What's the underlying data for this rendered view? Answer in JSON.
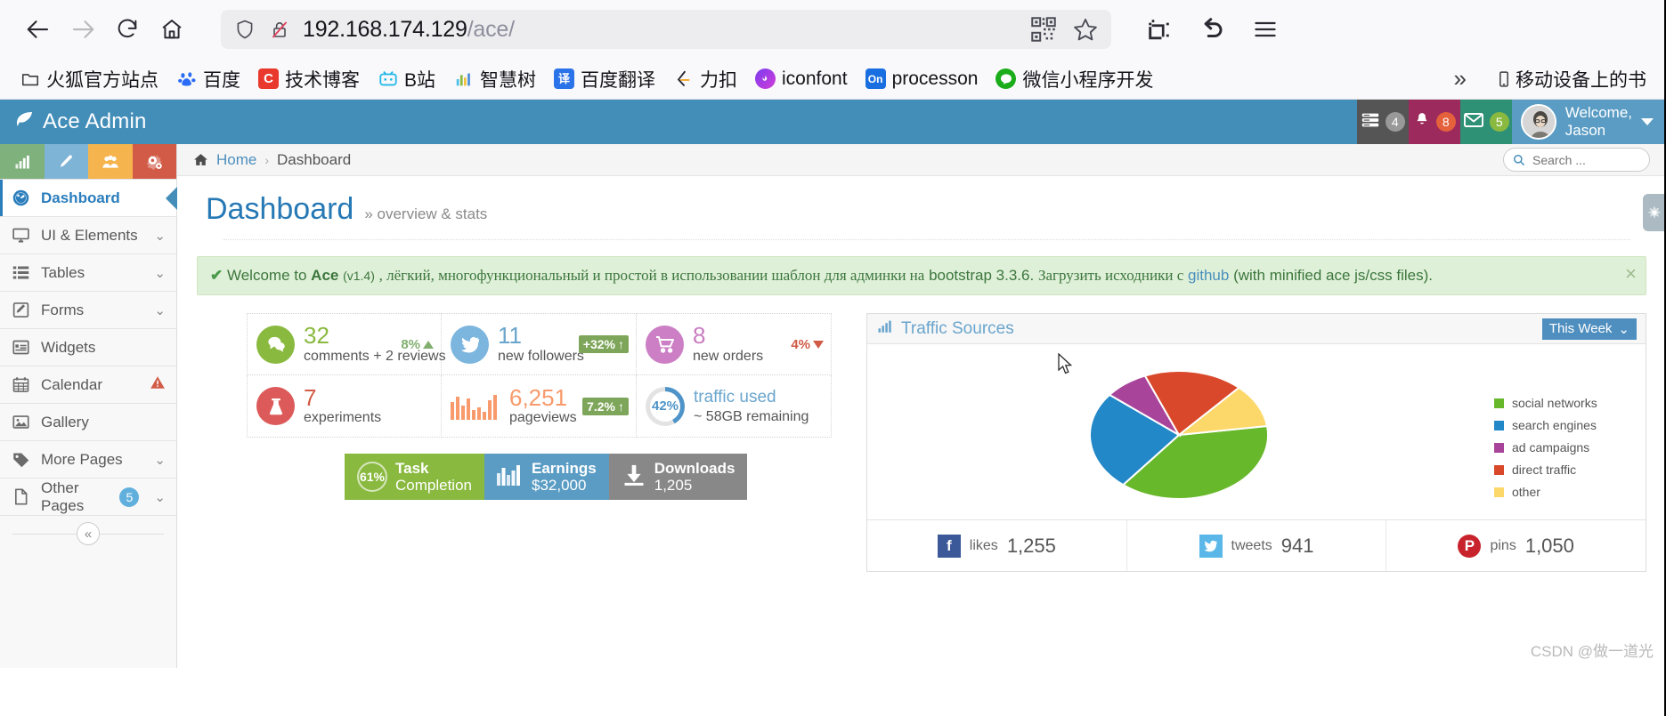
{
  "browser": {
    "url_host": "192.168.174.129",
    "url_path": "/ace/",
    "back_icon": "back-arrow-icon",
    "forward_icon": "forward-arrow-icon",
    "reload_icon": "reload-icon",
    "home_icon": "home-icon",
    "shield_icon": "shield-icon",
    "lock_broken_icon": "lock-crossed-icon",
    "qr_icon": "qr-code-icon",
    "star_icon": "bookmark-star-icon",
    "screenshot_icon": "screenshot-crop-icon",
    "undo_icon": "undo-arrow-icon",
    "menu_icon": "hamburger-menu-icon",
    "bookmarks": [
      {
        "label": "火狐官方站点",
        "icon": "folder-icon",
        "color": "#ffffff"
      },
      {
        "label": "百度",
        "icon": "baidu-paw-icon",
        "color": "#ffffff"
      },
      {
        "label": "技术博客",
        "icon": "csdn-c-icon",
        "color": "#e8392c"
      },
      {
        "label": "B站",
        "icon": "bilibili-icon",
        "color": "#ffffff"
      },
      {
        "label": "智慧树",
        "icon": "zhihuishu-bars-icon",
        "color": "#ffffff"
      },
      {
        "label": "百度翻译",
        "icon": "fanyi-icon",
        "color": "#2b73e8"
      },
      {
        "label": "力扣",
        "icon": "leetcode-icon",
        "color": "#ffffff"
      },
      {
        "label": "iconfont",
        "icon": "iconfont-icon",
        "color": "#8b3de8"
      },
      {
        "label": "processon",
        "icon": "processon-on-icon",
        "color": "#1a6fe0"
      },
      {
        "label": "微信小程序开发",
        "icon": "wechat-icon",
        "color": "#1aad19"
      }
    ],
    "overflow_label": "移动设备上的书",
    "overflow_chevron": "»",
    "mobile_icon": "mobile-device-icon"
  },
  "app": {
    "brand": "Ace Admin",
    "brand_icon": "leaf-icon",
    "shortcuts": [
      {
        "name": "stats-shortcut",
        "icon": "bar-chart-icon",
        "color": "#7eb17c"
      },
      {
        "name": "edit-shortcut",
        "icon": "pencil-icon",
        "color": "#7eb4d6"
      },
      {
        "name": "users-shortcut",
        "icon": "group-icon",
        "color": "#f5b44d"
      },
      {
        "name": "settings-shortcut",
        "icon": "cogs-icon",
        "color": "#d15b47"
      }
    ],
    "navbar": {
      "tasks": {
        "icon": "tasks-icon",
        "count": "4"
      },
      "notifications": {
        "icon": "bell-icon",
        "count": "8"
      },
      "mail": {
        "icon": "envelope-icon",
        "count": "5"
      },
      "user": {
        "greeting": "Welcome,",
        "name": "Jason",
        "avatar": "user-avatar"
      }
    }
  },
  "sidebar": {
    "items": [
      {
        "label": "Dashboard",
        "icon": "dashboard-gauge-icon",
        "active": true,
        "chevron": "",
        "badge": "",
        "warn": false
      },
      {
        "label": "UI & Elements",
        "icon": "desktop-icon",
        "active": false,
        "chevron": "⌄",
        "badge": "",
        "warn": false
      },
      {
        "label": "Tables",
        "icon": "list-icon",
        "active": false,
        "chevron": "⌄",
        "badge": "",
        "warn": false
      },
      {
        "label": "Forms",
        "icon": "form-edit-icon",
        "active": false,
        "chevron": "⌄",
        "badge": "",
        "warn": false
      },
      {
        "label": "Widgets",
        "icon": "widget-icon",
        "active": false,
        "chevron": "",
        "badge": "",
        "warn": false
      },
      {
        "label": "Calendar",
        "icon": "calendar-icon",
        "active": false,
        "chevron": "",
        "badge": "",
        "warn": true
      },
      {
        "label": "Gallery",
        "icon": "image-icon",
        "active": false,
        "chevron": "",
        "badge": "",
        "warn": false
      },
      {
        "label": "More Pages",
        "icon": "tag-icon",
        "active": false,
        "chevron": "⌄",
        "badge": "",
        "warn": false
      },
      {
        "label": "Other Pages",
        "icon": "file-icon",
        "active": false,
        "chevron": "⌄",
        "badge": "5",
        "warn": false
      }
    ],
    "collapse_icon": "«"
  },
  "breadcrumb": {
    "home_icon": "home-icon",
    "home": "Home",
    "separator": "›",
    "current": "Dashboard",
    "search_placeholder": "Search ...",
    "search_value": "",
    "search_icon": "search-icon"
  },
  "page": {
    "title": "Dashboard",
    "subtitle": "» overview & stats",
    "settings_tab_icon": "gear-icon"
  },
  "alert": {
    "check_icon": "check-icon",
    "welcome": "Welcome to",
    "brand": "Ace",
    "version": "(v1.4)",
    "text_ru_1": ", лёгкий, многофункциональный и простой в использовании шаблон для админки на",
    "bootstrap": "bootstrap 3.3.6.",
    "text_ru_2": "Загрузить исходники с",
    "link": "github",
    "text_tail": "(with minified ace js/css files).",
    "close_icon": "×"
  },
  "stats": [
    {
      "icon": "comments-icon",
      "icon_color": "#8ab93f",
      "value": "32",
      "value_color": "#8ab93f",
      "caption": "comments + 2 reviews",
      "trend": "8%",
      "trend_style": "plain-green",
      "trend_dir": "up"
    },
    {
      "icon": "twitter-icon",
      "icon_color": "#7cb5de",
      "value": "11",
      "value_color": "#6aa5cd",
      "caption": "new followers",
      "trend": "+32%",
      "trend_style": "chip",
      "trend_dir": "up"
    },
    {
      "icon": "cart-icon",
      "icon_color": "#cc7fc4",
      "value": "8",
      "value_color": "#c97dc0",
      "caption": "new orders",
      "trend": "4%",
      "trend_style": "plain-red",
      "trend_dir": "down"
    },
    {
      "icon": "flask-icon",
      "icon_color": "#dd5a5a",
      "value": "7",
      "value_color": "#d15b47",
      "caption": "experiments",
      "trend": "",
      "trend_style": "",
      "trend_dir": ""
    },
    {
      "icon": "sparkline-bars-icon",
      "icon_color": "#f89a6b",
      "value": "6,251",
      "value_color": "#f89a6b",
      "caption": "pageviews",
      "trend": "7.2%",
      "trend_style": "chip",
      "trend_dir": "up"
    },
    {
      "icon": "donut-42-icon",
      "icon_color": "#4f94c8",
      "value": "",
      "value_color": "#6aa5cd",
      "caption": "traffic used",
      "caption2": "~ 58GB remaining",
      "donut_pct": "42%",
      "trend": "",
      "trend_style": "",
      "trend_dir": ""
    }
  ],
  "bands": [
    {
      "name": "task-completion",
      "pct": "61%",
      "line1": "Task",
      "line2": "Completion",
      "color": "#8ab93f",
      "icon": "percent-circle-icon"
    },
    {
      "name": "earnings",
      "line1": "Earnings",
      "line2": "$32,000",
      "color": "#5a9cc4",
      "icon": "bar-chart-icon"
    },
    {
      "name": "downloads",
      "line1": "Downloads",
      "line2": "1,205",
      "color": "#888888",
      "icon": "download-icon"
    }
  ],
  "traffic": {
    "title": "Traffic Sources",
    "title_icon": "bar-chart-icon",
    "period_label": "This Week",
    "period_caret": "⌄",
    "social": [
      {
        "name": "likes",
        "icon": "facebook-icon",
        "color": "#3b5998",
        "value": "1,255"
      },
      {
        "name": "tweets",
        "icon": "twitter-icon",
        "color": "#5bb7e8",
        "value": "941"
      },
      {
        "name": "pins",
        "icon": "pinterest-icon",
        "color": "#c8232c",
        "value": "1,050"
      }
    ]
  },
  "chart_data": {
    "type": "pie",
    "title": "Traffic Sources",
    "labels": [
      "social networks",
      "search engines",
      "ad campaigns",
      "direct traffic",
      "other"
    ],
    "values": [
      38,
      25,
      8,
      18,
      11
    ],
    "colors": [
      "#68b82c",
      "#2288c8",
      "#a8449a",
      "#d9482b",
      "#fcd濃"
    ],
    "legend_position": "right",
    "grid": false
  },
  "watermark": "CSDN @做一道光"
}
